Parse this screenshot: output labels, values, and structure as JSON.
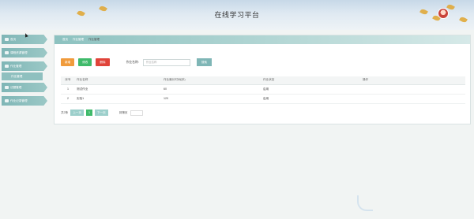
{
  "header": {
    "title": "在线学习平台",
    "user": ""
  },
  "sidebar": {
    "items": [
      {
        "label": "首页"
      },
      {
        "label": "课程资源管理"
      },
      {
        "label": "作业管理"
      },
      {
        "label": "作业管理",
        "sub": true
      },
      {
        "label": "试题管理"
      },
      {
        "label": "作业记录管理"
      }
    ]
  },
  "breadcrumb": [
    "首页",
    "作业管理",
    "作业管理"
  ],
  "toolbar": {
    "add": "新增",
    "edit": "修改",
    "del": "删除",
    "search_label": "作业名称:",
    "search_placeholder": "作业名称",
    "search_btn": "搜索"
  },
  "table": {
    "headers": [
      "序号",
      "作业名称",
      "作业最长时间(秒)",
      "作业状态",
      "操作"
    ],
    "rows": [
      [
        "1",
        "测试作业",
        "60",
        "启用",
        ""
      ],
      [
        "2",
        "实验1",
        "120",
        "启用",
        ""
      ]
    ]
  },
  "pager": {
    "total": "共2条",
    "prev": "上一页",
    "page": "1",
    "next": "下一页",
    "goto": "到第页"
  }
}
